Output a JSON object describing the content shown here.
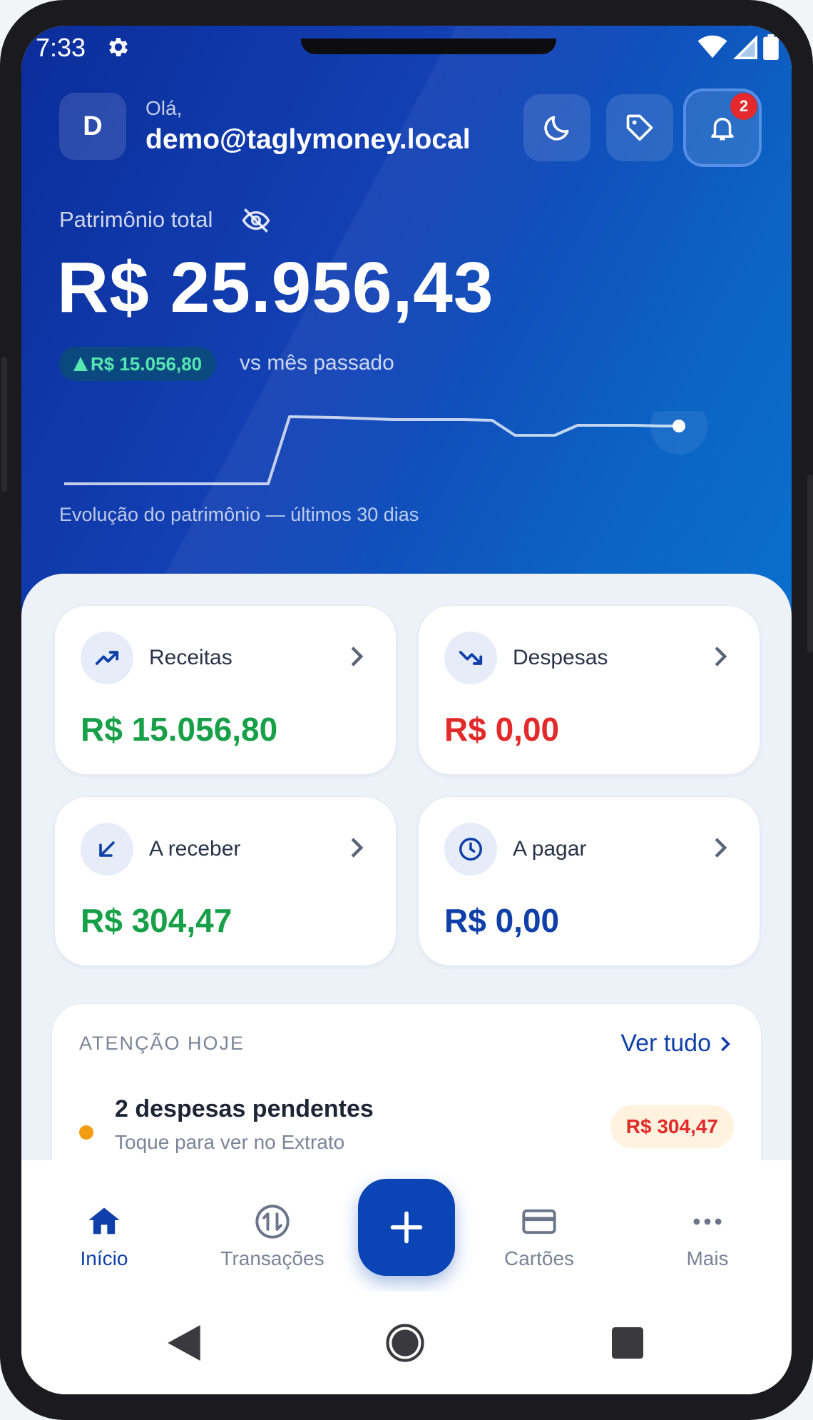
{
  "status_bar": {
    "time": "7:33"
  },
  "header": {
    "avatar_initial": "D",
    "greeting": "Olá,",
    "email": "demo@taglymoney.local",
    "notification_count": "2"
  },
  "patrimonio": {
    "label": "Patrimônio total",
    "value": "R$ 25.956,43",
    "delta": "R$ 15.056,80",
    "delta_caption": "vs mês passado",
    "chart_caption": "Evolução do patrimônio — últimos 30 dias"
  },
  "cards": {
    "receitas": {
      "label": "Receitas",
      "value": "R$ 15.056,80"
    },
    "despesas": {
      "label": "Despesas",
      "value": "R$ 0,00"
    },
    "a_receber": {
      "label": "A receber",
      "value": "R$ 304,47"
    },
    "a_pagar": {
      "label": "A pagar",
      "value": "R$ 0,00"
    }
  },
  "attention": {
    "title": "ATENÇÃO HOJE",
    "link": "Ver tudo",
    "item_title": "2 despesas pendentes",
    "item_subtitle": "Toque para ver no Extrato",
    "item_amount": "R$ 304,47"
  },
  "nav": {
    "inicio": "Início",
    "transacoes": "Transações",
    "cartoes": "Cartões",
    "mais": "Mais"
  },
  "colors": {
    "accent": "#0f3fa8",
    "income": "#17a048",
    "expense": "#e22a2a",
    "warning_dot": "#f39c12"
  }
}
